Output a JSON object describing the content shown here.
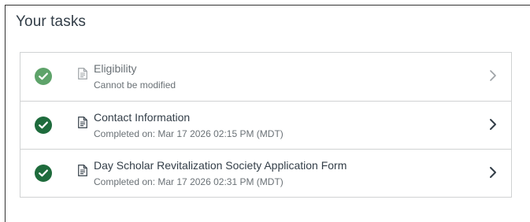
{
  "page_title": "Your tasks",
  "colors": {
    "complete_dark": "#1e6b3c",
    "complete_light": "#5ea36a",
    "chevron_dark": "#333e48",
    "chevron_light": "#9da2a6"
  },
  "tasks": [
    {
      "name": "Eligibility",
      "subtitle": "Cannot be modified",
      "status": "complete",
      "status_icon": "check-circle-icon",
      "doc_icon": "document-icon",
      "state": "disabled"
    },
    {
      "name": "Contact Information",
      "subtitle": "Completed on: Mar 17 2026 02:15 PM (MDT)",
      "status": "complete",
      "status_icon": "check-circle-icon",
      "doc_icon": "document-icon",
      "state": "active"
    },
    {
      "name": "Day Scholar Revitalization Society Application Form",
      "subtitle": "Completed on: Mar 17 2026 02:31 PM (MDT)",
      "status": "complete",
      "status_icon": "check-circle-icon",
      "doc_icon": "document-icon",
      "state": "active"
    }
  ]
}
